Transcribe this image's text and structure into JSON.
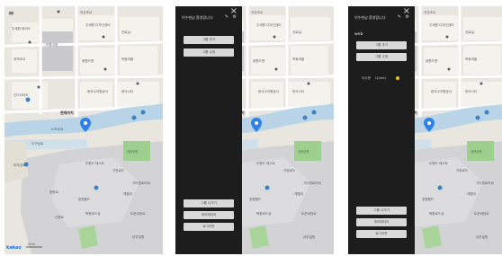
{
  "map": {
    "labels": {
      "a": "지산초교",
      "b": "주세원 바이오",
      "c": "주세원 디자인센터",
      "d": "진료실",
      "e": "도원고대",
      "f": "지역초교",
      "g": "옥동마을",
      "h": "동원드앤",
      "i": "한국수자원공사",
      "j": "한국시티",
      "k": "신디라더이",
      "l": "현제위치",
      "m": "생태공원",
      "n": "노보소이",
      "o": "도원드 테스트",
      "p": "피자업소",
      "q": "가장로드",
      "r": "기타원로타워",
      "s": "동원월드",
      "t": "북원로드상",
      "u": "동원로",
      "v": "캐렐리",
      "w": "트운비한로",
      "x": "신원로",
      "y": "남부일원",
      "z": "오구남로"
    },
    "current_location": "현재위치",
    "scale": "50m",
    "brand": "kakao"
  },
  "drawer": {
    "greeting": "이수현님 환영합니다.",
    "close_icon": "×",
    "edit_icon": "✎",
    "settings_icon": "⚙",
    "add_group": "그룹 추가",
    "edit_group": "그룹 수정",
    "leave_group": "그룹 나가기",
    "my_page": "마이페이지",
    "logout": "로그아웃",
    "group_name": "web",
    "member_name": "이수현",
    "member_status": "나(me)"
  },
  "colors": {
    "drawer_bg": "#1d1d1d",
    "button_bg": "#d9d9d9",
    "map_bg": "#e9e6e0",
    "water": "#b9d4e6",
    "park": "#9dcf8f",
    "marker": "#2f80ed",
    "status_dot": "#f0c419"
  }
}
